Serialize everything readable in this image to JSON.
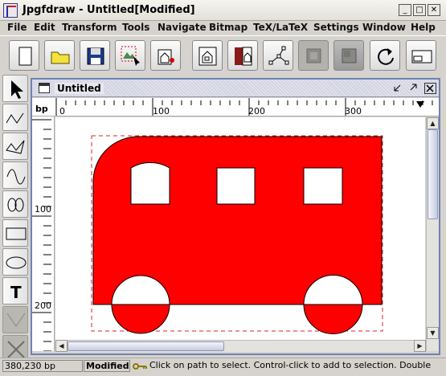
{
  "window": {
    "title": "Jpgfdraw - Untitled[Modified]",
    "minimize": "_",
    "maximize": "□",
    "close": "✕"
  },
  "menu": [
    "File",
    "Edit",
    "Transform",
    "Tools",
    "Navigate",
    "Bitmap",
    "TeX/LaTeX",
    "Settings",
    "Window",
    "Help"
  ],
  "toolbar": {
    "icons": [
      "new-file-icon",
      "open-folder-icon",
      "save-icon",
      "image-select-icon",
      "image-insert-icon",
      "image-frame-icon",
      "image-export-icon",
      "path-nodes-icon",
      "disabled-tool-icon",
      "pressed-tool-icon",
      "redraw-icon",
      "window-fit-icon"
    ]
  },
  "side_tools": [
    "select-arrow-icon",
    "open-line-icon",
    "closed-line-icon",
    "curve-icon",
    "loop-icon",
    "rectangle-icon",
    "ellipse-icon",
    "text-tool-icon",
    "math-tool-icon",
    "cross-tool-icon"
  ],
  "side_tool_text": "T",
  "document": {
    "title": "Untitled",
    "unit": "bp",
    "ruler_top_labels": [
      "0",
      "100",
      "200",
      "300"
    ],
    "ruler_left_labels": [
      "100",
      "200"
    ]
  },
  "colors": {
    "shape_fill": "#ff0000",
    "selection_box": "#dd2222",
    "frame_border": "#6e82b4"
  },
  "status": {
    "coords": "380,230 bp",
    "modified": "Modified",
    "message": "Click on path to select. Control-click to add to selection. Double"
  }
}
